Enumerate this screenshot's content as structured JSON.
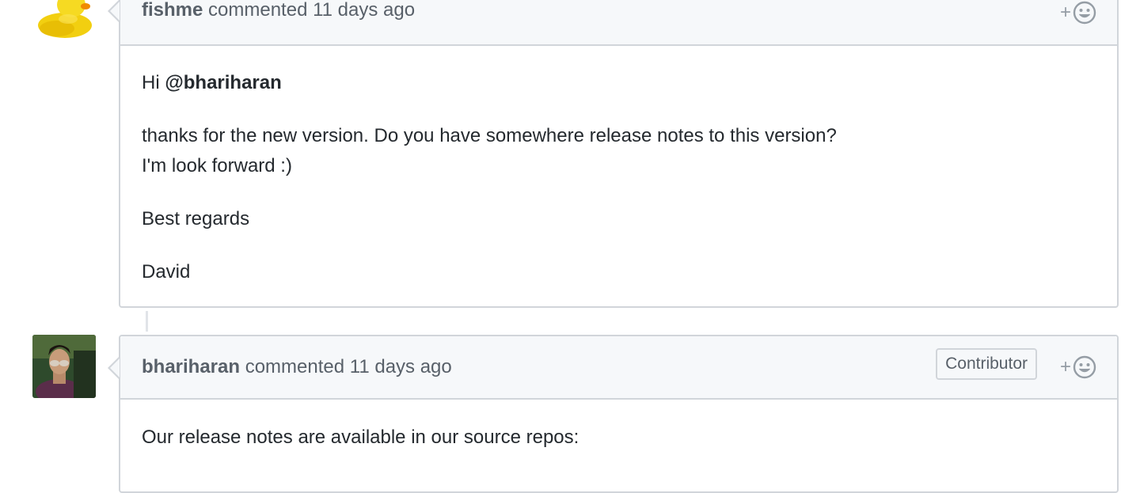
{
  "comments": [
    {
      "author": "fishme",
      "action": "commented",
      "time": "11 days ago",
      "avatar": "rubber-duck",
      "body": {
        "greeting": "Hi",
        "mention": "@bhariharan",
        "line1": "thanks for the new version. Do you have somewhere release notes to this version?",
        "line2": "I'm look forward :)",
        "closing": "Best regards",
        "signature": "David"
      }
    },
    {
      "author": "bhariharan",
      "action": "commented",
      "time": "11 days ago",
      "avatar": "user-photo",
      "badge": "Contributor",
      "body": {
        "text": "Our release notes are available in our source repos:"
      }
    }
  ],
  "reaction": {
    "plus": "+",
    "icon": "smiley-icon"
  },
  "colors": {
    "header_bg": "#f6f8fa",
    "border": "#d1d5da",
    "muted_text": "#586069",
    "body_text": "#24292e",
    "duck_yellow": "#f5d90a"
  }
}
